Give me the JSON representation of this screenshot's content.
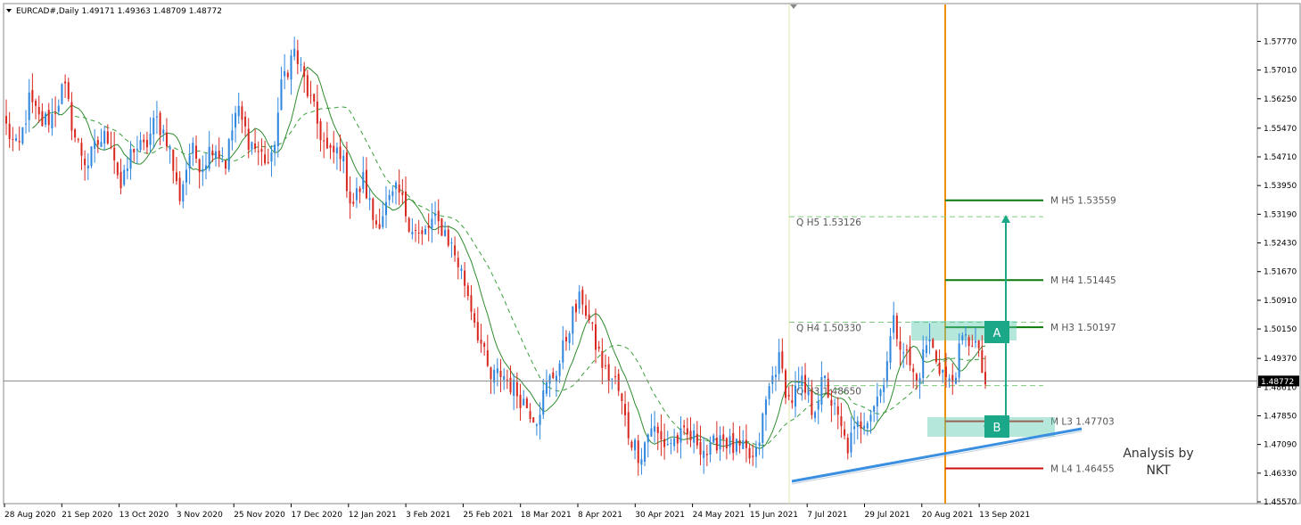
{
  "chart_data": {
    "type": "candlestick",
    "symbol_header": "EURCAD#,Daily  1.49171 1.49363 1.48709 1.48772",
    "current_price": "1.48772",
    "ylim": [
      1.4557,
      1.5804
    ],
    "y_ticks": [
      "1.57770",
      "1.57010",
      "1.56250",
      "1.55470",
      "1.54710",
      "1.53950",
      "1.53190",
      "1.52430",
      "1.51670",
      "1.50910",
      "1.50150",
      "1.49370",
      "1.48610",
      "1.47850",
      "1.47090",
      "1.46330",
      "1.45570"
    ],
    "x_ticks": [
      "28 Aug 2020",
      "21 Sep 2020",
      "13 Oct 2020",
      "3 Nov 2020",
      "25 Nov 2020",
      "17 Dec 2020",
      "12 Jan 2021",
      "3 Feb 2021",
      "25 Feb 2021",
      "18 Mar 2021",
      "8 Apr 2021",
      "30 Apr 2021",
      "24 May 2021",
      "15 Jun 2021",
      "7 Jul 2021",
      "29 Jul 2021",
      "20 Aug 2021",
      "13 Sep 2021"
    ],
    "close_path": [
      1.555,
      1.548,
      1.562,
      1.556,
      1.558,
      1.566,
      1.552,
      1.545,
      1.551,
      1.553,
      1.538,
      1.55,
      1.549,
      1.557,
      1.552,
      1.536,
      1.549,
      1.545,
      1.551,
      1.545,
      1.56,
      1.552,
      1.548,
      1.545,
      1.568,
      1.575,
      1.566,
      1.556,
      1.547,
      1.549,
      1.534,
      1.541,
      1.529,
      1.534,
      1.538,
      1.53,
      1.525,
      1.53,
      1.528,
      1.521,
      1.512,
      1.5,
      1.488,
      1.49,
      1.486,
      1.482,
      1.478,
      1.487,
      1.492,
      1.504,
      1.51,
      1.499,
      1.49,
      1.487,
      1.474,
      1.468,
      1.476,
      1.471,
      1.472,
      1.473,
      1.472,
      1.468,
      1.474,
      1.47,
      1.469,
      1.466,
      1.483,
      1.494,
      1.482,
      1.487,
      1.48,
      1.488,
      1.479,
      1.47,
      1.476,
      1.48,
      1.486,
      1.503,
      1.496,
      1.487,
      1.499,
      1.492,
      1.486,
      1.498,
      1.499,
      1.487
    ],
    "pivot_levels": [
      {
        "label": "M  H5 1.53559",
        "value": 1.53559,
        "color": "#0a7a0a",
        "style": "solid"
      },
      {
        "label": "Q  H5 1.53126",
        "value": 1.53126,
        "color": "#7fcc7f",
        "style": "dashed"
      },
      {
        "label": "M  H4 1.51445",
        "value": 1.51445,
        "color": "#0a7a0a",
        "style": "solid"
      },
      {
        "label": "Q  H4 1.50330",
        "value": 1.5033,
        "color": "#7fcc7f",
        "style": "dashed"
      },
      {
        "label": "M  H3 1.50197",
        "value": 1.50197,
        "color": "#0a7a0a",
        "style": "solid"
      },
      {
        "label": "Q  H3 1.48650",
        "value": 1.4865,
        "color": "#7fcc7f",
        "style": "dashed"
      },
      {
        "label": "M  L3 1.47703",
        "value": 1.47703,
        "color": "#cc1111",
        "style": "solid"
      },
      {
        "label": "M  L4 1.46455",
        "value": 1.46455,
        "color": "#cc1111",
        "style": "solid"
      }
    ],
    "zone_a_label": "A",
    "zone_b_label": "B",
    "annotation": "Analysis by NKT",
    "colors": {
      "bull": "#2e86de",
      "bear": "#d8281f",
      "ma_fast": "#2e8b2e",
      "ma_slow": "#3aa03a",
      "trendline": "#3b8fe0",
      "vline_orange": "#f0900a",
      "vline_yellow": "#dfe9a8",
      "zone": "#5cc9b0",
      "box": "#1aa888"
    }
  }
}
